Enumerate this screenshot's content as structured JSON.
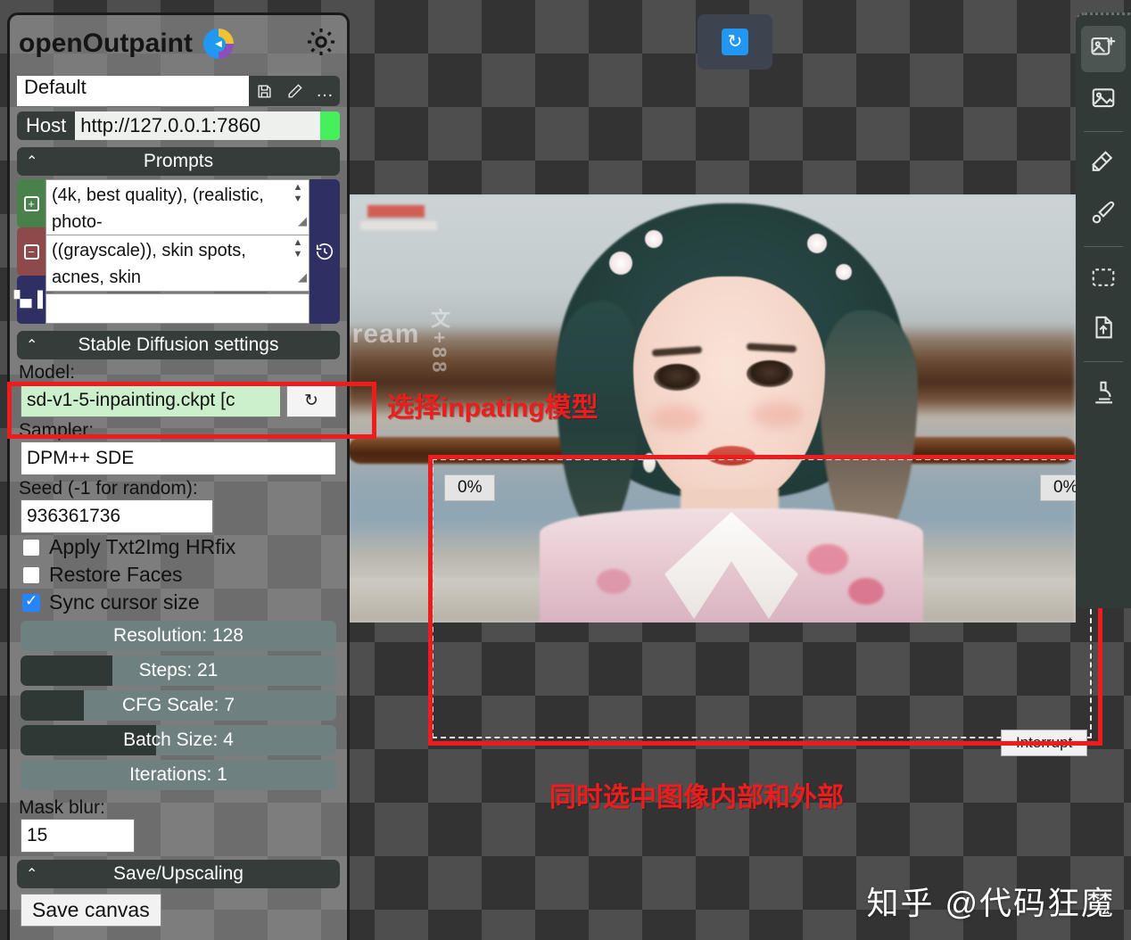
{
  "app": {
    "title": "openOutpaint",
    "logo_icon": "openoutpaint-logo",
    "settings_icon": "gear-icon"
  },
  "preset": {
    "value": "Default",
    "save_icon": "floppy-save-icon",
    "edit_icon": "pencil-icon",
    "more_label": "…"
  },
  "host": {
    "label": "Host",
    "value": "http://127.0.0.1:7860",
    "status_color": "#46f05c"
  },
  "sections": {
    "prompts": {
      "label": "Prompts",
      "chevron": "⌃"
    },
    "sd_settings": {
      "label": "Stable Diffusion settings",
      "chevron": "⌃"
    },
    "save_upscaling": {
      "label": "Save/Upscaling",
      "chevron": "⌃"
    }
  },
  "prompts": {
    "positive": "(4k, best quality), (realistic, photo-",
    "negative": "((grayscale)), skin spots, acnes, skin",
    "extra": "",
    "add_icon": "plus-square-icon",
    "remove_icon": "minus-square-icon",
    "stats_icon": "histogram-icon",
    "history_icon": "history-clock-icon"
  },
  "sd": {
    "model_label": "Model:",
    "model_value": "sd-v1-5-inpainting.ckpt [c",
    "model_refresh_icon": "refresh-icon",
    "sampler_label": "Sampler:",
    "sampler_value": "DPM++ SDE",
    "seed_label": "Seed (-1 for random):",
    "seed_value": "936361736",
    "checkboxes": [
      {
        "label": "Apply Txt2Img HRfix",
        "checked": false
      },
      {
        "label": "Restore Faces",
        "checked": false
      },
      {
        "label": "Sync cursor size",
        "checked": true
      }
    ],
    "sliders": [
      {
        "label": "Resolution: 128",
        "value": 128,
        "fill_pct": 0
      },
      {
        "label": "Steps: 21",
        "value": 21,
        "fill_pct": 29
      },
      {
        "label": "CFG Scale: 7",
        "value": 7,
        "fill_pct": 20
      },
      {
        "label": "Batch Size: 4",
        "value": 4,
        "fill_pct": 43
      },
      {
        "label": "Iterations: 1",
        "value": 1,
        "fill_pct": 0
      }
    ],
    "mask_blur_label": "Mask blur:",
    "mask_blur_value": "15"
  },
  "save": {
    "save_canvas_label": "Save canvas"
  },
  "toolbar": {
    "items": [
      {
        "name": "add-image-tool",
        "icon": "image-plus-icon",
        "active": true
      },
      {
        "name": "image-tool",
        "icon": "image-icon",
        "active": false
      },
      {
        "name": "stamp-tool",
        "icon": "stamp-icon",
        "active": false
      },
      {
        "name": "brush-tool",
        "icon": "brush-icon",
        "active": false
      },
      {
        "name": "select-tool",
        "icon": "dashed-marquee-icon",
        "active": false
      },
      {
        "name": "upload-tool",
        "icon": "file-upload-icon",
        "active": false
      },
      {
        "name": "microscope-tool",
        "icon": "microscope-icon",
        "active": false
      }
    ]
  },
  "canvas": {
    "refresh_button_icon": "sync-refresh-icon",
    "image_watermark": "Dream",
    "image_watermark_vertical": "文+88",
    "progress_left": "0%",
    "progress_right": "0%",
    "interrupt_label": "Interrupt"
  },
  "annotations": {
    "note_model": "选择inpating模型",
    "note_selection": "同时选中图像内部和外部",
    "color": "#ee1c1c"
  },
  "watermark": {
    "text": "知乎 @代码狂魔"
  }
}
